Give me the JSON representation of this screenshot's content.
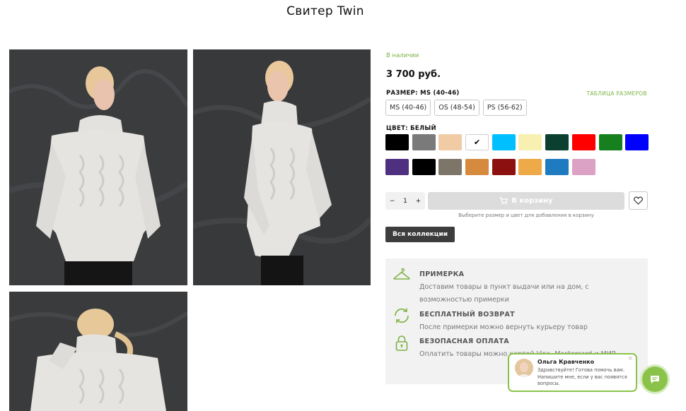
{
  "product": {
    "title": "Свитер Twin",
    "availability": "В наличии",
    "price": "3 700 руб."
  },
  "photos": [
    {
      "name": "front-view"
    },
    {
      "name": "side-view"
    },
    {
      "name": "back-view"
    }
  ],
  "size": {
    "heading": "РАЗМЕР: MS (40-46)",
    "table_link": "ТАБЛИЦА РАЗМЕРОВ",
    "options": [
      "MS (40-46)",
      "OS (48-54)",
      "PS (56-62)"
    ]
  },
  "color": {
    "heading": "ЦВЕТ: БЕЛЫЙ",
    "selected_index": 3,
    "swatches": [
      "#000000",
      "#7a7a7a",
      "#f0cba6",
      "#ffffff",
      "#00bfff",
      "#f8f0b0",
      "#0b4030",
      "#ff0000",
      "#17801e",
      "#0000ff",
      "#4f2f7f",
      "#000000",
      "#7d7668",
      "#d58a3e",
      "#8c1010",
      "#eea948",
      "#1f7bc0",
      "#dba2c6"
    ]
  },
  "cart": {
    "qty_minus": "−",
    "qty_value": "1",
    "qty_plus": "+",
    "button_label": "В корзину",
    "hint": "Выберите размер и цвет для добавления в корзину"
  },
  "collections_button": "Вся коллекции",
  "info": [
    {
      "icon": "hanger-icon",
      "title": "ПРИМЕРКА",
      "text": "Доставим товары в пункт выдачи или на дом, с возможностью примерки"
    },
    {
      "icon": "return-arrows-icon",
      "title": "БЕСПЛАТНЫЙ ВОЗВРАТ",
      "text": "После примерки можно вернуть курьеру товар"
    },
    {
      "icon": "lock-icon",
      "title": "БЕЗОПАСНАЯ ОПЛАТА",
      "text": "Оплатить товары можно картой Visa, Mastercard и МИР"
    }
  ],
  "chat": {
    "name": "Ольга Кравченко",
    "message": "Здравствуйте! Готова помочь вам. Напишите мне, если у вас появятся вопросы.",
    "close": "×"
  },
  "colors": {
    "accent": "#8bc34a",
    "link": "#7cb342",
    "dark_button": "#3d3d3d",
    "info_bg": "#f2f2f2"
  }
}
